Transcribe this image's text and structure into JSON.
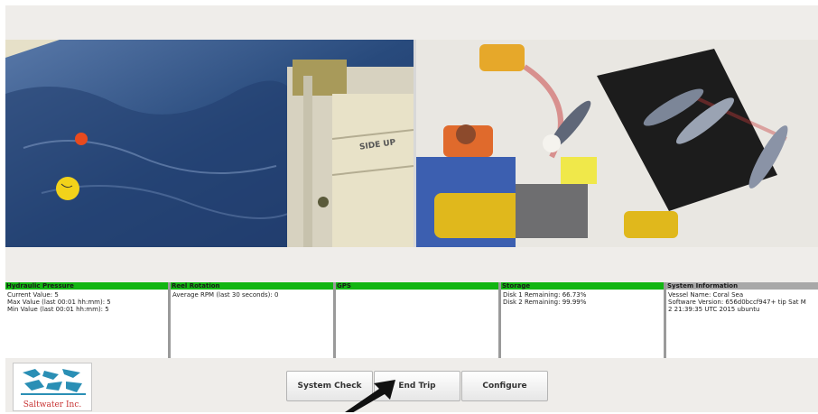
{
  "panels": [
    {
      "title": "Hydraulic Pressure",
      "header_color": "#12b512",
      "lines": [
        "Current Value: 5",
        "Max Value (last 00:01 hh:mm): 5",
        "Min Value (last 00:01 hh:mm): 5"
      ]
    },
    {
      "title": "Reel Rotation",
      "header_color": "#12b512",
      "lines": [
        "Average RPM (last 30 seconds): 0"
      ]
    },
    {
      "title": "GPS",
      "header_color": "#12b512",
      "lines": []
    },
    {
      "title": "Storage",
      "header_color": "#12b512",
      "lines": [
        "Disk 1 Remaining: 66.73%",
        "Disk 2 Remaining: 99.99%"
      ]
    },
    {
      "title": "System Information",
      "header_color": "#a8a8a8",
      "lines": [
        "Vessel Name: Coral Sea",
        "Software Version: 656d0bccf947+ tip Sat M",
        "2 21:39:35 UTC 2015 ubuntu"
      ]
    }
  ],
  "buttons": {
    "system_check": "System Check",
    "end_trip": "End Trip",
    "configure": "Configure"
  },
  "logo": {
    "text": "Saltwater Inc.",
    "accent": "#2a8fb5"
  },
  "camera_overlay_text": "SIDE UP"
}
